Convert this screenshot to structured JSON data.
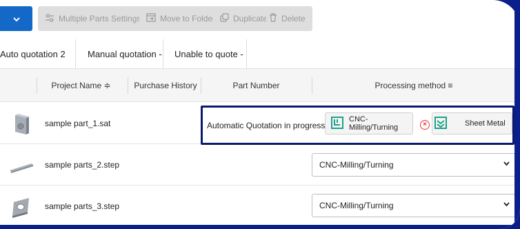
{
  "toolbar": {
    "dropdown_icon": "chevron-down-icon",
    "buttons": [
      {
        "label": "Multiple Parts Settings",
        "icon": "sliders-icon"
      },
      {
        "label": "Move to Folder",
        "icon": "folder-move-icon"
      },
      {
        "label": "Duplicate",
        "icon": "duplicate-icon"
      },
      {
        "label": "Delete",
        "icon": "trash-icon"
      }
    ]
  },
  "tabs": [
    {
      "label": "Auto quotation 2"
    },
    {
      "label": "Manual quotation -"
    },
    {
      "label": "Unable to quote -"
    }
  ],
  "table": {
    "headers": {
      "project_name": "Project Name ≑",
      "purchase_history": "Purchase History",
      "part_number": "Part Number",
      "processing_method": "Processing method ≡"
    },
    "rows": [
      {
        "name": "sample part_1.sat",
        "status": "Automatic Quotation in progress",
        "methods": [
          "CNC-Milling/Turning",
          "Sheet Metal"
        ]
      },
      {
        "name": "sample parts_2.step",
        "select_value": "CNC-Milling/Turning"
      },
      {
        "name": "sample parts_3.step",
        "select_value": "CNC-Milling/Turning"
      }
    ]
  },
  "colors": {
    "accent": "#1469c8",
    "frame": "#0b1f8c",
    "highlight_border": "#0a1a6e",
    "method_icon": "#1aa38a",
    "remove_icon": "#e33333"
  }
}
